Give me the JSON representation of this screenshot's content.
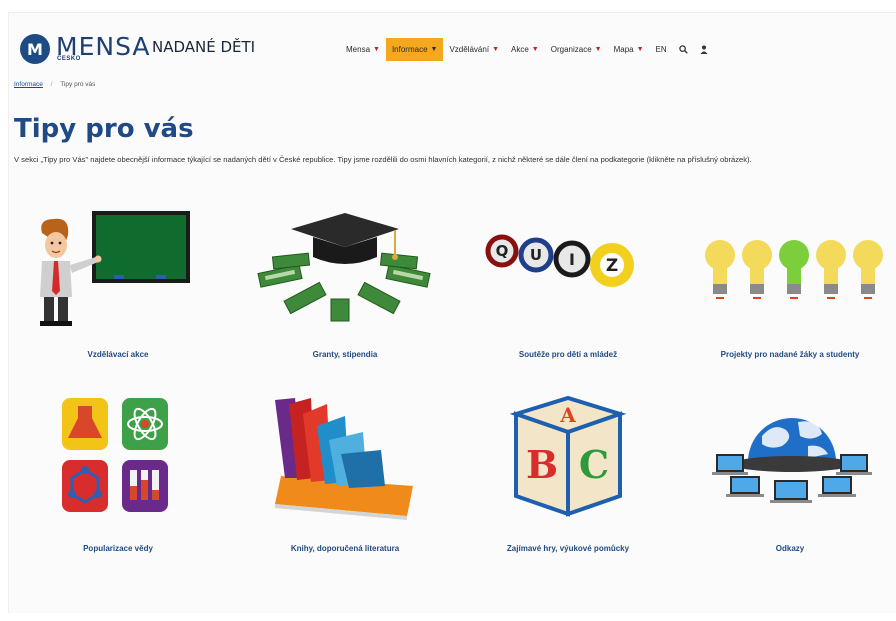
{
  "header": {
    "logo_initials": "M",
    "logo_text": "MENSA",
    "logo_sub": "ČESKO",
    "site_name": "NADANÉ DĚTI"
  },
  "nav": {
    "items": [
      {
        "label": "Mensa",
        "active": false
      },
      {
        "label": "Informace",
        "active": true
      },
      {
        "label": "Vzdělávání",
        "active": false
      },
      {
        "label": "Akce",
        "active": false
      },
      {
        "label": "Organizace",
        "active": false
      },
      {
        "label": "Mapa",
        "active": false
      }
    ],
    "lang": "EN",
    "caret": "▼",
    "search_icon": "🔍",
    "user_icon": "👤"
  },
  "breadcrumb": {
    "parent": "Informace",
    "separator": "/",
    "current": "Tipy pro vás"
  },
  "page": {
    "title": "Tipy pro vás",
    "intro": "V sekci „Tipy pro Vás\" najdete obecnější informace týkající se nadaných dětí v České republice. Tipy jsme rozdělili do osmi hlavních kategorií, z nichž některé se dále člení na podkategorie (klikněte na příslušný obrázek)."
  },
  "tiles": [
    {
      "caption": "Vzdělávací akce",
      "icon": "teacher-board"
    },
    {
      "caption": "Granty, stipendia",
      "icon": "graduation-cap-money"
    },
    {
      "caption": "Soutěže pro děti a mládež",
      "icon": "quiz-balls"
    },
    {
      "caption": "Projekty pro nadané žáky a studenty",
      "icon": "light-bulbs"
    },
    {
      "caption": "Popularizace vědy",
      "icon": "science-icons"
    },
    {
      "caption": "Knihy, doporučená literatura",
      "icon": "books"
    },
    {
      "caption": "Zajímavé hry, výukové pomůcky",
      "icon": "abc-cube"
    },
    {
      "caption": "Odkazy",
      "icon": "globe-laptops"
    }
  ],
  "quiz_letters": [
    "Q",
    "U",
    "I",
    "Z"
  ],
  "cube_letters": [
    "A",
    "B",
    "C"
  ],
  "colors": {
    "brand_blue": "#1f4a85",
    "nav_active": "#f4a81d",
    "caret_red": "#c9221b"
  }
}
